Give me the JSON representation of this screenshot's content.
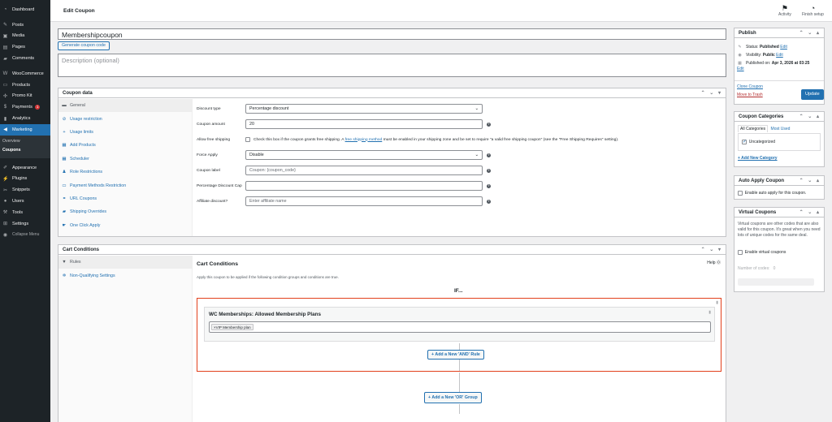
{
  "sidebar": {
    "items": [
      {
        "label": "Dashboard",
        "icon": "dashboard-icon",
        "glyph": "◔"
      },
      {
        "label": "Posts",
        "icon": "pin-icon",
        "glyph": "✎"
      },
      {
        "label": "Media",
        "icon": "media-icon",
        "glyph": "▣"
      },
      {
        "label": "Pages",
        "icon": "pages-icon",
        "glyph": "▤"
      },
      {
        "label": "Comments",
        "icon": "comments-icon",
        "glyph": "▰"
      },
      {
        "label": "WooCommerce",
        "icon": "woo-icon",
        "glyph": "W"
      },
      {
        "label": "Products",
        "icon": "products-icon",
        "glyph": "▭"
      },
      {
        "label": "Promo Kit",
        "icon": "promo-icon",
        "glyph": "✣"
      },
      {
        "label": "Payments",
        "icon": "payments-icon",
        "glyph": "$",
        "badge": "1"
      },
      {
        "label": "Analytics",
        "icon": "analytics-icon",
        "glyph": "▮"
      },
      {
        "label": "Marketing",
        "icon": "megaphone-icon",
        "glyph": "◀"
      },
      {
        "label": "Appearance",
        "icon": "brush-icon",
        "glyph": "✐"
      },
      {
        "label": "Plugins",
        "icon": "plugin-icon",
        "glyph": "⚡"
      },
      {
        "label": "Snippets",
        "icon": "snippets-icon",
        "glyph": "✂"
      },
      {
        "label": "Users",
        "icon": "users-icon",
        "glyph": "●"
      },
      {
        "label": "Tools",
        "icon": "tools-icon",
        "glyph": "⚒"
      },
      {
        "label": "Settings",
        "icon": "settings-icon",
        "glyph": "⊞"
      },
      {
        "label": "Collapse Menu",
        "icon": "collapse-icon",
        "glyph": "◉"
      }
    ],
    "submenu": [
      "Overview",
      "Coupons"
    ]
  },
  "topbar": {
    "title": "Edit Coupon",
    "activity": "Activity",
    "finish_setup": "Finish setup"
  },
  "post": {
    "title": "Membershipcoupon",
    "generate_button": "Generate coupon code",
    "description_placeholder": "Description (optional)"
  },
  "coupon_data": {
    "heading": "Coupon data",
    "tabs": [
      {
        "label": "General",
        "icon": "ticket-icon",
        "glyph": "▬"
      },
      {
        "label": "Usage restriction",
        "icon": "block-icon",
        "glyph": "⊘"
      },
      {
        "label": "Usage limits",
        "icon": "plus-icon",
        "glyph": "+"
      },
      {
        "label": "Add Products",
        "icon": "cart-icon",
        "glyph": "▦"
      },
      {
        "label": "Scheduler",
        "icon": "calendar-icon",
        "glyph": "▦"
      },
      {
        "label": "Role Restrictions",
        "icon": "user-icon",
        "glyph": "♟"
      },
      {
        "label": "Payment Methods Restriction",
        "icon": "card-icon",
        "glyph": "▭"
      },
      {
        "label": "URL Coupons",
        "icon": "link-icon",
        "glyph": "⚭"
      },
      {
        "label": "Shipping Overrides",
        "icon": "truck-icon",
        "glyph": "▰"
      },
      {
        "label": "One Click Apply",
        "icon": "pointer-icon",
        "glyph": "☛"
      }
    ],
    "fields": {
      "discount_type_label": "Discount type",
      "discount_type_value": "Percentage discount",
      "coupon_amount_label": "Coupon amount",
      "coupon_amount_value": "20",
      "free_shipping_label": "Allow free shipping",
      "free_shipping_text_before": "Check this box if the coupon grants free shipping. A",
      "free_shipping_link": "free shipping method",
      "free_shipping_text_after": "must be enabled in your shipping zone and be set to require \"a valid free shipping coupon\" (see the \"Free Shipping Requires\" setting).",
      "force_apply_label": "Force Apply",
      "force_apply_value": "Disable",
      "coupon_label_label": "Coupon label",
      "coupon_label_placeholder": "Coupon: {coupon_code}",
      "pct_cap_label": "Percentage Discount Cap",
      "pct_cap_value": "",
      "affiliate_label": "Affiliate discount?",
      "affiliate_placeholder": "Enter affiliate name"
    }
  },
  "cart_conditions": {
    "heading": "Cart Conditions",
    "tabs": [
      {
        "label": "Rules",
        "icon": "filter-icon",
        "glyph": "▼"
      },
      {
        "label": "Non-Qualifying Settings",
        "icon": "gear-icon",
        "glyph": "✲"
      }
    ],
    "title": "Cart Conditions",
    "help": "Help",
    "description": "Apply this coupon to be applied if the following condition groups and conditions are true.",
    "if_label": "IF...",
    "rule_title": "WC Memberships: Allowed Membership Plans",
    "selected_plan": "VIP Membership plan",
    "add_and_rule": "Add a New 'AND' Rule",
    "add_or_group": "Add a New 'OR' Group"
  },
  "publish": {
    "heading": "Publish",
    "status_label": "Status:",
    "status_value": "Published",
    "visibility_label": "Visibility:",
    "visibility_value": "Public",
    "published_label": "Published on:",
    "published_value": "Apr 3, 2026 at 03:25",
    "edit": "Edit",
    "clone": "Clone Coupon",
    "trash": "Move to Trash",
    "update": "Update"
  },
  "categories": {
    "heading": "Coupon Categories",
    "tab_all": "All Categories",
    "tab_used": "Most Used",
    "item": "Uncategorized",
    "add_new": "+ Add New Category"
  },
  "auto_apply": {
    "heading": "Auto Apply Coupon",
    "label": "Enable auto apply for this coupon."
  },
  "virtual": {
    "heading": "Virtual Coupons",
    "description": "Virtual coupons are other codes that are also valid for this coupon. It's great when you need lots of unique codes for the same deal.",
    "checkbox": "Enable virtual coupons",
    "number_label": "Number of codes:",
    "number_value": "0"
  },
  "colors": {
    "accent": "#2271b1",
    "sidebar": "#1d2327",
    "group_border": "#e2401c"
  }
}
